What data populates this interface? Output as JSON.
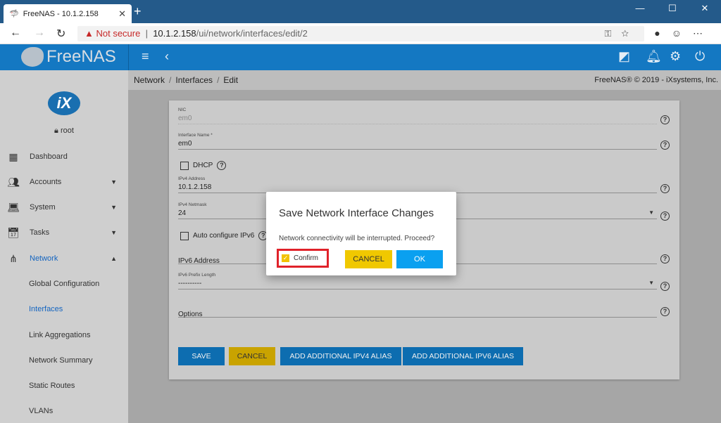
{
  "browser": {
    "tab_title": "FreeNAS - 10.1.2.158",
    "security": "Not secure",
    "url_host": "10.1.2.158",
    "url_path": "/ui/network/interfaces/edit/2"
  },
  "header": {
    "logo": "FreeNAS"
  },
  "breadcrumb": {
    "items": [
      "Network",
      "Interfaces",
      "Edit"
    ],
    "copyright": "FreeNAS® © 2019 - iXsystems, Inc."
  },
  "sidebar": {
    "user": "root",
    "items": [
      {
        "label": "Dashboard",
        "icon": "dashboard-icon"
      },
      {
        "label": "Accounts",
        "icon": "people-icon"
      },
      {
        "label": "System",
        "icon": "laptop-icon"
      },
      {
        "label": "Tasks",
        "icon": "calendar-icon"
      },
      {
        "label": "Network",
        "icon": "network-icon"
      }
    ],
    "subitems": [
      "Global Configuration",
      "Interfaces",
      "Link Aggregations",
      "Network Summary",
      "Static Routes",
      "VLANs"
    ]
  },
  "form": {
    "nic_label": "NIC",
    "nic_value": "em0",
    "name_label": "Interface Name *",
    "name_value": "em0",
    "dhcp": "DHCP",
    "ipv4_label": "IPv4 Address",
    "ipv4_value": "10.1.2.158",
    "netmask_label": "IPv4 Netmask",
    "netmask_value": "24",
    "autoconf": "Auto configure IPv6",
    "ipv6_placeholder": "IPv6 Address",
    "prefix_label": "IPv6 Prefix Length",
    "prefix_value": "----------",
    "options_placeholder": "Options",
    "buttons": {
      "save": "SAVE",
      "cancel": "CANCEL",
      "add_ipv4": "ADD ADDITIONAL IPV4 ALIAS",
      "add_ipv6": "ADD ADDITIONAL IPV6 ALIAS"
    }
  },
  "dialog": {
    "title": "Save Network Interface Changes",
    "message": "Network connectivity will be interrupted. Proceed?",
    "confirm": "Confirm",
    "confirm_checked": true,
    "cancel": "CANCEL",
    "ok": "OK"
  }
}
